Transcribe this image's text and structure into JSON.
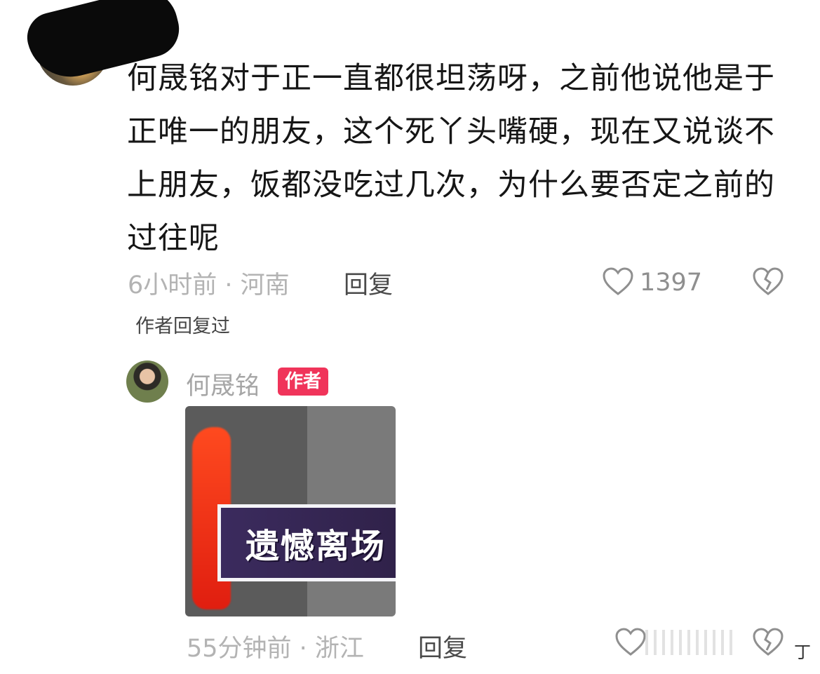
{
  "comment": {
    "text": "何晟铭对于正一直都很坦荡呀，之前他说他是于正唯一的朋友，这个死丫头嘴硬，现在又说谈不上朋友，饭都没吃过几次，为什么要否定之前的过往呢",
    "meta": "6小时前 · 河南",
    "reply_label": "回复",
    "like_count": "1397",
    "author_replied_label": "作者回复过"
  },
  "reply": {
    "author_name": "何晟铭",
    "author_badge": "作者",
    "sticker_text": "遗憾离场",
    "meta": "55分钟前 · 浙江",
    "reply_label": "回复",
    "tail_text": "丁"
  },
  "colors": {
    "badge": "#f0345a",
    "meta_text": "#b3b3b3",
    "body_text": "#161616"
  },
  "icons": {
    "like": "heart-outline-icon",
    "dislike": "broken-heart-icon"
  }
}
